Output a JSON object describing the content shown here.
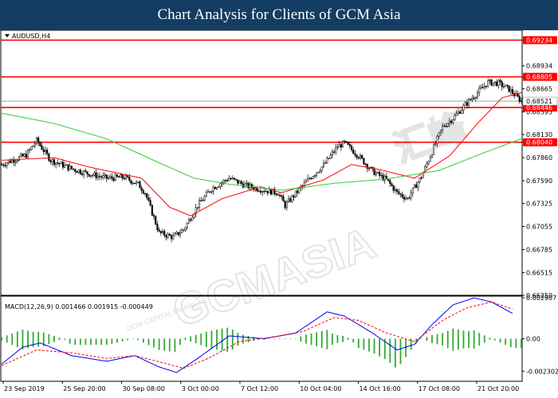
{
  "banner": {
    "title": "Chart Analysis for Clients of GCM Asia"
  },
  "watermark": {
    "brand": "GCMASIA",
    "brand_cn": "汇峰",
    "tagline": "GCM CAPITAL MARKETS"
  },
  "colors": {
    "banner": "#133d63",
    "resistance": "#ff0000",
    "ma_fast": "#ff0000",
    "ma_slow": "#33cc33",
    "macd_line": "#0000ff",
    "signal_line": "#ff0000",
    "histogram": "#33aa33",
    "price_line": "#999999"
  },
  "chart_data": [
    {
      "type": "candlestick",
      "title": "AUDUSD,H4",
      "ylim": [
        0.6625,
        0.6935
      ],
      "y_ticks": [
        "0.69234",
        "0.68934",
        "0.68805",
        "0.68665",
        "0.68521",
        "0.68446",
        "0.68395",
        "0.68130",
        "0.68040",
        "0.67860",
        "0.67590",
        "0.67325",
        "0.67055",
        "0.66785",
        "0.66515",
        "0.66250"
      ],
      "horizontal_levels": [
        0.69234,
        0.68805,
        0.68446,
        0.6804
      ],
      "current_price": 0.68521,
      "x_tick_labels": [
        "23 Sep 2019",
        "25 Sep 20:00",
        "30 Sep 08:00",
        "3 Oct 00:00",
        "7 Oct 12:00",
        "10 Oct 04:00",
        "14 Oct 16:00",
        "17 Oct 08:00",
        "21 Oct 20:00"
      ],
      "close_path": [
        [
          0,
          0.6778
        ],
        [
          14,
          0.6789
        ],
        [
          20,
          0.6806
        ],
        [
          28,
          0.6783
        ],
        [
          40,
          0.6773
        ],
        [
          50,
          0.6767
        ],
        [
          60,
          0.6762
        ],
        [
          70,
          0.6763
        ],
        [
          78,
          0.6755
        ],
        [
          82,
          0.6745
        ],
        [
          90,
          0.6698
        ],
        [
          98,
          0.6693
        ],
        [
          104,
          0.6702
        ],
        [
          112,
          0.673
        ],
        [
          120,
          0.675
        ],
        [
          130,
          0.6762
        ],
        [
          140,
          0.6753
        ],
        [
          150,
          0.6748
        ],
        [
          158,
          0.6745
        ],
        [
          162,
          0.673
        ],
        [
          168,
          0.6744
        ],
        [
          176,
          0.6762
        ],
        [
          184,
          0.6777
        ],
        [
          192,
          0.6799
        ],
        [
          196,
          0.6803
        ],
        [
          204,
          0.6788
        ],
        [
          212,
          0.677
        ],
        [
          220,
          0.676
        ],
        [
          226,
          0.6745
        ],
        [
          232,
          0.6738
        ],
        [
          240,
          0.6764
        ],
        [
          246,
          0.6793
        ],
        [
          252,
          0.6822
        ],
        [
          258,
          0.6832
        ],
        [
          266,
          0.685
        ],
        [
          272,
          0.6862
        ],
        [
          278,
          0.6874
        ],
        [
          284,
          0.6873
        ],
        [
          290,
          0.6866
        ],
        [
          297,
          0.6852
        ]
      ],
      "series": [
        {
          "values": [
            [
              0,
              0.6783
            ],
            [
              30,
              0.6786
            ],
            [
              50,
              0.6775
            ],
            [
              80,
              0.6762
            ],
            [
              96,
              0.6728
            ],
            [
              108,
              0.6718
            ],
            [
              126,
              0.6738
            ],
            [
              148,
              0.6752
            ],
            [
              160,
              0.6745
            ],
            [
              184,
              0.676
            ],
            [
              200,
              0.6778
            ],
            [
              216,
              0.6772
            ],
            [
              236,
              0.6762
            ],
            [
              256,
              0.6788
            ],
            [
              272,
              0.6826
            ],
            [
              286,
              0.6856
            ],
            [
              297,
              0.6862
            ]
          ]
        },
        {
          "values": [
            [
              0,
              0.6838
            ],
            [
              30,
              0.6826
            ],
            [
              60,
              0.6808
            ],
            [
              90,
              0.678
            ],
            [
              110,
              0.6762
            ],
            [
              130,
              0.6755
            ],
            [
              160,
              0.6748
            ],
            [
              190,
              0.6756
            ],
            [
              220,
              0.6761
            ],
            [
              250,
              0.6771
            ],
            [
              276,
              0.6792
            ],
            [
              297,
              0.6808
            ]
          ]
        }
      ]
    },
    {
      "type": "macd",
      "title": "MACD(12,26,9) 0.001466 0.001915 -0.000449",
      "ylim": [
        -0.00302,
        0.00302
      ],
      "y_ticks": [
        "0.002907",
        "0.00",
        "-0.002302"
      ],
      "series": [
        {
          "values": [
            [
              0,
              -0.0018
            ],
            [
              12,
              -0.0006
            ],
            [
              22,
              -0.0003
            ],
            [
              40,
              -0.0012
            ],
            [
              60,
              -0.0016
            ],
            [
              76,
              -0.0012
            ],
            [
              90,
              -0.002
            ],
            [
              100,
              -0.0024
            ],
            [
              112,
              -0.0014
            ],
            [
              130,
              0.0002
            ],
            [
              150,
              0.0
            ],
            [
              168,
              0.0004
            ],
            [
              186,
              0.0019
            ],
            [
              196,
              0.0016
            ],
            [
              212,
              0.0004
            ],
            [
              226,
              -0.0008
            ],
            [
              236,
              -0.0004
            ],
            [
              246,
              0.001
            ],
            [
              258,
              0.0024
            ],
            [
              270,
              0.0029
            ],
            [
              280,
              0.0026
            ],
            [
              292,
              0.0018
            ]
          ]
        },
        {
          "values": [
            [
              0,
              -0.0019
            ],
            [
              20,
              -0.0008
            ],
            [
              40,
              -0.001
            ],
            [
              60,
              -0.0014
            ],
            [
              76,
              -0.0012
            ],
            [
              92,
              -0.0017
            ],
            [
              104,
              -0.0021
            ],
            [
              118,
              -0.0014
            ],
            [
              136,
              -0.0002
            ],
            [
              154,
              0.0001
            ],
            [
              172,
              0.0005
            ],
            [
              190,
              0.0015
            ],
            [
              204,
              0.0013
            ],
            [
              220,
              0.0004
            ],
            [
              236,
              -0.0002
            ],
            [
              252,
              0.0013
            ],
            [
              266,
              0.0022
            ],
            [
              280,
              0.0026
            ],
            [
              292,
              0.0021
            ]
          ]
        }
      ]
    }
  ]
}
